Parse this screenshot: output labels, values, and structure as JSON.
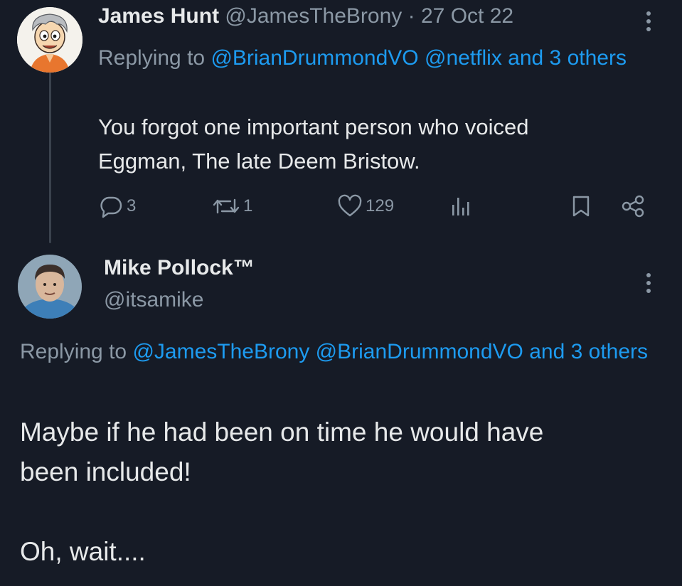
{
  "tweet1": {
    "display_name": "James Hunt",
    "handle": "@JamesTheBrony",
    "separator": "·",
    "date": "27 Oct 22",
    "replying_prefix": "Replying to",
    "reply_mention_1": "@BrianDrummondVO",
    "reply_mention_2": "@netflix",
    "reply_suffix": "and 3 others",
    "body_line_1": "You forgot one important person who voiced",
    "body_line_2": "Eggman, The late Deem Bristow.",
    "actions": {
      "replies": "3",
      "reposts": "1",
      "likes": "129"
    },
    "icons": {
      "avatar": "cartoon-avatar-icon",
      "more": "more-vertical-icon",
      "reply": "reply-bubble-icon",
      "repost": "repost-icon",
      "like": "heart-icon",
      "views": "views-chart-icon",
      "bookmark": "bookmark-icon",
      "share": "share-icon"
    }
  },
  "tweet2": {
    "display_name": "Mike Pollock™",
    "handle": "@itsamike",
    "replying_prefix": "Replying to",
    "reply_mention_1": "@JamesTheBrony",
    "reply_mention_2": "@BrianDrummondVO",
    "reply_suffix": "and 3 others",
    "body_line_1": "Maybe if he had been on time he would have",
    "body_line_2": "been included!",
    "body_line_3": "Oh, wait....",
    "icons": {
      "avatar": "photo-avatar-icon",
      "more": "more-vertical-icon"
    }
  },
  "colors": {
    "background": "#161b26",
    "text": "#e7e9ea",
    "muted": "#8b98a5",
    "link": "#1d9bf0"
  }
}
